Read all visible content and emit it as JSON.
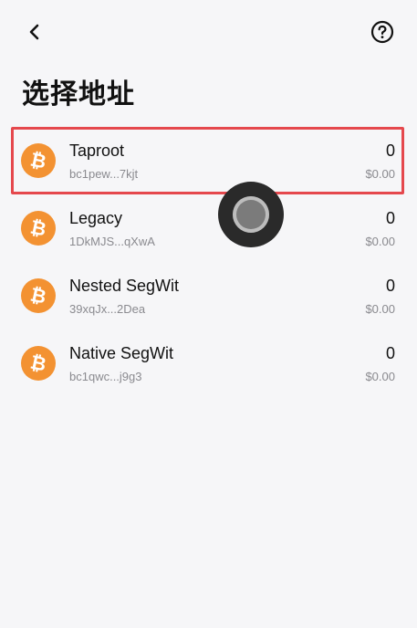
{
  "header": {
    "back_icon": "chevron-left-icon",
    "help_icon": "question-circle-icon",
    "title": "选择地址"
  },
  "accent_colors": {
    "selected_border": "#e5484d",
    "bitcoin": "#f39232"
  },
  "addresses": [
    {
      "name": "Taproot",
      "address": "bc1pew...7kjt",
      "amount": "0",
      "fiat": "$0.00",
      "selected": true,
      "icon": "bitcoin-icon"
    },
    {
      "name": "Legacy",
      "address": "1DkMJS...qXwA",
      "amount": "0",
      "fiat": "$0.00",
      "selected": false,
      "icon": "bitcoin-icon"
    },
    {
      "name": "Nested SegWit",
      "address": "39xqJx...2Dea",
      "amount": "0",
      "fiat": "$0.00",
      "selected": false,
      "icon": "bitcoin-icon"
    },
    {
      "name": "Native SegWit",
      "address": "bc1qwc...j9g3",
      "amount": "0",
      "fiat": "$0.00",
      "selected": false,
      "icon": "bitcoin-icon"
    }
  ]
}
